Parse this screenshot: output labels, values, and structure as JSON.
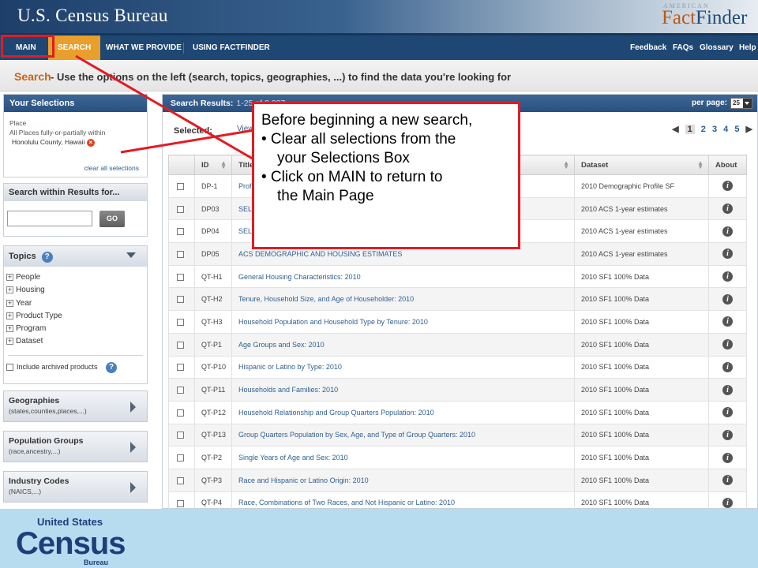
{
  "header": {
    "brand": "U.S. Census Bureau",
    "ff_small": "AMERICAN",
    "ff_fact": "Fact",
    "ff_finder": "Finder"
  },
  "nav": {
    "main": "MAIN",
    "search": "SEARCH",
    "what": "WHAT WE PROVIDE",
    "using": "USING FACTFINDER",
    "feedback": "Feedback",
    "faqs": "FAQs",
    "glossary": "Glossary",
    "help": "Help"
  },
  "page": {
    "title": "Search",
    "desc": "- Use the options on the left (search, topics, geographies, ...) to find the data you're looking for"
  },
  "selections": {
    "header": "Your Selections",
    "label": "Place",
    "line1": "All Places fully-or-partially within",
    "line2": "Honolulu County, Hawaii",
    "clear": "clear all selections"
  },
  "search_within": {
    "header": "Search within Results for...",
    "go": "GO"
  },
  "topics": {
    "header": "Topics",
    "items": [
      "People",
      "Housing",
      "Year",
      "Product Type",
      "Program",
      "Dataset"
    ],
    "archived": "Include archived products"
  },
  "accordions": [
    {
      "title": "Geographies",
      "sub": "(states,counties,places,...)"
    },
    {
      "title": "Population Groups",
      "sub": "(race,ancestry,...)"
    },
    {
      "title": "Industry Codes",
      "sub": "(NAICS,...)"
    }
  ],
  "results": {
    "header": "Search Results:",
    "count": "1-25 of 2,327",
    "per_page_label": "per page:",
    "per_page": "25",
    "selected": "Selected:",
    "view": "View",
    "pages": [
      "1",
      "2",
      "3",
      "4",
      "5"
    ],
    "columns": {
      "id": "ID",
      "title": "Title",
      "dataset": "Dataset",
      "about": "About"
    },
    "rows": [
      {
        "id": "DP-1",
        "title": "Profile of General Population and Housing Characteristics: 2010",
        "dataset": "2010 Demographic Profile SF"
      },
      {
        "id": "DP03",
        "title": "SELECTED ECONOMIC CHARACTERISTICS",
        "dataset": "2010 ACS 1-year estimates"
      },
      {
        "id": "DP04",
        "title": "SELECTED HOUSING CHARACTERISTICS",
        "dataset": "2010 ACS 1-year estimates"
      },
      {
        "id": "DP05",
        "title": "ACS DEMOGRAPHIC AND HOUSING ESTIMATES",
        "dataset": "2010 ACS 1-year estimates"
      },
      {
        "id": "QT-H1",
        "title": "General Housing Characteristics: 2010",
        "dataset": "2010 SF1 100% Data"
      },
      {
        "id": "QT-H2",
        "title": "Tenure, Household Size, and Age of Householder: 2010",
        "dataset": "2010 SF1 100% Data"
      },
      {
        "id": "QT-H3",
        "title": "Household Population and Household Type by Tenure: 2010",
        "dataset": "2010 SF1 100% Data"
      },
      {
        "id": "QT-P1",
        "title": "Age Groups and Sex: 2010",
        "dataset": "2010 SF1 100% Data"
      },
      {
        "id": "QT-P10",
        "title": "Hispanic or Latino by Type: 2010",
        "dataset": "2010 SF1 100% Data"
      },
      {
        "id": "QT-P11",
        "title": "Households and Families: 2010",
        "dataset": "2010 SF1 100% Data"
      },
      {
        "id": "QT-P12",
        "title": "Household Relationship and Group Quarters Population: 2010",
        "dataset": "2010 SF1 100% Data"
      },
      {
        "id": "QT-P13",
        "title": "Group Quarters Population by Sex, Age, and Type of Group Quarters: 2010",
        "dataset": "2010 SF1 100% Data"
      },
      {
        "id": "QT-P2",
        "title": "Single Years of Age and Sex: 2010",
        "dataset": "2010 SF1 100% Data"
      },
      {
        "id": "QT-P3",
        "title": "Race and Hispanic or Latino Origin: 2010",
        "dataset": "2010 SF1 100% Data"
      },
      {
        "id": "QT-P4",
        "title": "Race, Combinations of Two Races, and Not Hispanic or Latino: 2010",
        "dataset": "2010 SF1 100% Data"
      }
    ]
  },
  "callout": {
    "line1": "Before beginning a new search,",
    "b1a": "• Clear all selections from the",
    "b1b": "your Selections Box",
    "b2a": "• Click on MAIN to return to",
    "b2b": "the Main Page"
  },
  "footer": {
    "united_states": "United States",
    "census": "Census",
    "bureau": "Bureau"
  },
  "colors": {
    "accent_orange": "#e99f2b",
    "nav_blue": "#1f4773",
    "annotation_red": "#e31b23"
  }
}
